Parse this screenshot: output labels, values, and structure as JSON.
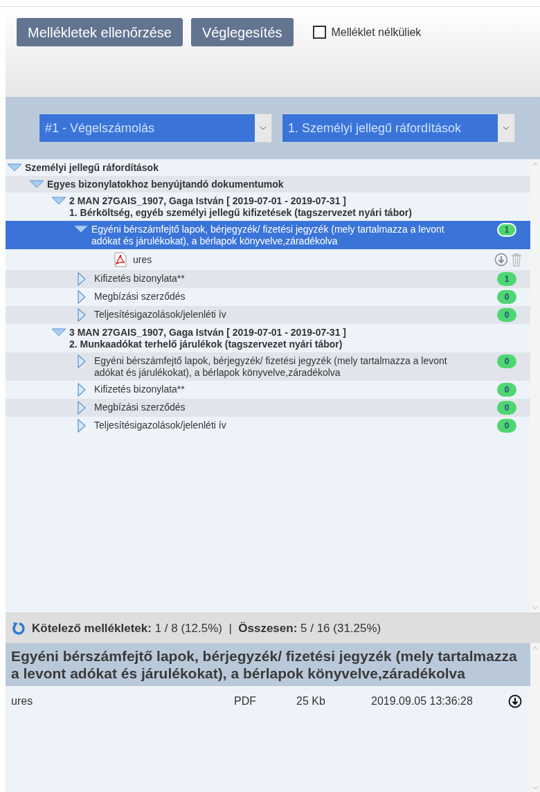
{
  "toolbar": {
    "buttons": [
      "Mellékletek ellenőrzése",
      "Véglegesítés"
    ],
    "checkbox": {
      "label": "Melléklet nélküliek",
      "checked": false
    }
  },
  "selects": [
    {
      "value": "#1 - Végelszámolás"
    },
    {
      "value": "1. Személyi jellegű ráfordítások"
    }
  ],
  "tree": [
    {
      "kind": "heading",
      "label": "Személyi jellegű ráfordítások",
      "expanded": true,
      "children": [
        {
          "kind": "heading",
          "label": "Egyes bizonylatokhoz benyújtandó dokumentumok",
          "expanded": true,
          "children": [
            {
              "kind": "heading",
              "label": "2 MAN 27GAIS_1907, Gaga István [ 2019-07-01 - 2019-07-31 ]",
              "sublabel": "1. Bérköltség, egyéb személyi jellegű kifizetések (tagszervezet nyári tábor)",
              "expanded": true,
              "children": [
                {
                  "kind": "document",
                  "label": "Egyéni bérszámfejtő lapok, bérjegyzék/ fizetési jegyzék (mely tartalmazza a levont adókat és járulékokat), a bérlapok könyvelve,záradékolva",
                  "count": "1",
                  "expanded": true,
                  "selected": true,
                  "children": [
                    {
                      "kind": "file",
                      "label": "ures"
                    }
                  ]
                },
                {
                  "kind": "document",
                  "label": "Kifizetés bizonylata**",
                  "count": "1",
                  "expanded": false,
                  "selected": false
                },
                {
                  "kind": "document",
                  "label": "Megbízási szerződés",
                  "count": "0",
                  "expanded": false,
                  "selected": false
                },
                {
                  "kind": "document",
                  "label": "Teljesítésigazolások/jelenléti ív",
                  "count": "0",
                  "expanded": false,
                  "selected": false
                }
              ]
            },
            {
              "kind": "heading",
              "label": "3 MAN 27GAIS_1907, Gaga István [ 2019-07-01 - 2019-07-31 ]",
              "sublabel": "2. Munkaadókat terhelő járulékok (tagszervezet nyári tábor)",
              "expanded": true,
              "children": [
                {
                  "kind": "document",
                  "label": "Egyéni bérszámfejtő lapok, bérjegyzék/ fizetési jegyzék (mely tartalmazza a levont adókat és járulékokat), a bérlapok könyvelve,záradékolva",
                  "count": "0",
                  "expanded": false,
                  "selected": false
                },
                {
                  "kind": "document",
                  "label": "Kifizetés bizonylata**",
                  "count": "0",
                  "expanded": false,
                  "selected": false
                },
                {
                  "kind": "document",
                  "label": "Megbízási szerződés",
                  "count": "0",
                  "expanded": false,
                  "selected": false
                },
                {
                  "kind": "document",
                  "label": "Teljesítésigazolások/jelenléti ív",
                  "count": "0",
                  "expanded": false,
                  "selected": false
                }
              ]
            }
          ]
        }
      ]
    }
  ],
  "summary": "**Kötelező mellékletek:** 1 / 8 (12.5%)  |  **Összesen:** 5 / 16 (31.25%)",
  "detail": {
    "title": "Egyéni bérszámfejtő lapok, bérjegyzék/ fizetési jegyzék (mely tartalmazza a levont adókat és járulékokat), a bérlapok könyvelve,záradékolva",
    "files": [
      {
        "name": "ures",
        "type": "PDF",
        "size": "25 Kb",
        "date": "2019.09.05 13:36:28"
      }
    ]
  }
}
